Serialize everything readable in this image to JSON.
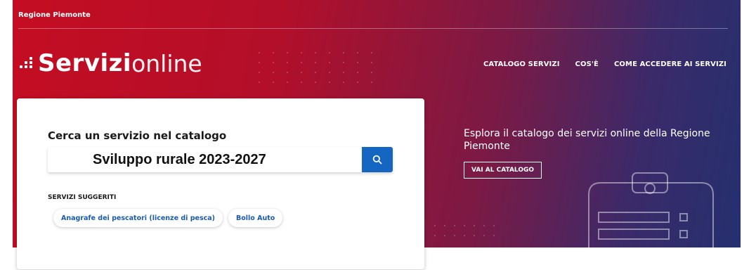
{
  "header": {
    "region_label": "Regione Piemonte",
    "brand_bold": "Servizi",
    "brand_light": "online",
    "nav": [
      {
        "label": "CATALOGO SERVIZI"
      },
      {
        "label": "COS'È"
      },
      {
        "label": "COME ACCEDERE AI SERVIZI"
      }
    ]
  },
  "search_card": {
    "title": "Cerca un servizio nel catalogo",
    "input_value": "Sviluppo rurale 2023-2027",
    "suggested_title": "SERVIZI SUGGERITI",
    "suggestions": [
      {
        "label": "Anagrafe dei pescatori (licenze di pesca)"
      },
      {
        "label": "Bollo Auto"
      }
    ]
  },
  "explore": {
    "text": "Esplora il catalogo dei servizi online della Regione Piemonte",
    "button_label": "VAI AL CATALOGO"
  },
  "icons": {
    "search": "search-icon",
    "illustration": "id-card-icon",
    "brand_mark": "dots-logo-icon"
  },
  "colors": {
    "hero_start": "#c40d22",
    "hero_end": "#25306e",
    "search_button": "#1566c3",
    "chip_text": "#1a5bb0"
  }
}
